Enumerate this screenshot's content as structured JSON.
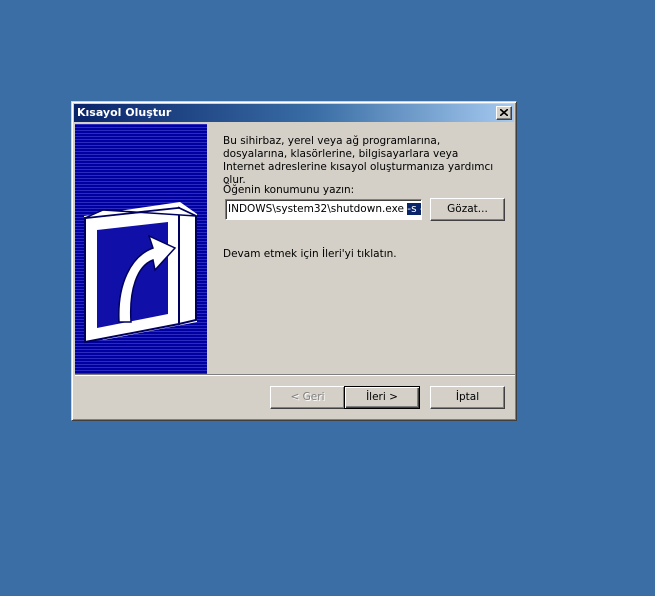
{
  "window": {
    "title": "Kısayol Oluştur"
  },
  "wizard": {
    "description": "Bu sihirbaz, yerel veya ağ programlarına, dosyalarına, klasörlerine, bilgisayarlara veya Internet adreslerine kısayol oluşturmanıza yardımcı olur.",
    "location_label": "Öğenin konumunu yazın:",
    "location_value": "INDOWS\\system32\\shutdown.exe ",
    "location_selected": "-s -f",
    "browse_label": "Gözat...",
    "next_hint": "Devam etmek için İleri'yi tıklatın."
  },
  "buttons": {
    "back_label": "< Geri",
    "next_label": "İleri >",
    "cancel_label": "İptal"
  },
  "icons": {
    "banner": "shortcut-arrow-icon",
    "close": "close-icon"
  },
  "colors": {
    "desktop": "#3a6ea5",
    "titlebar_start": "#0a246a",
    "banner": "#0000a8",
    "dialog": "#d4d0c8"
  }
}
